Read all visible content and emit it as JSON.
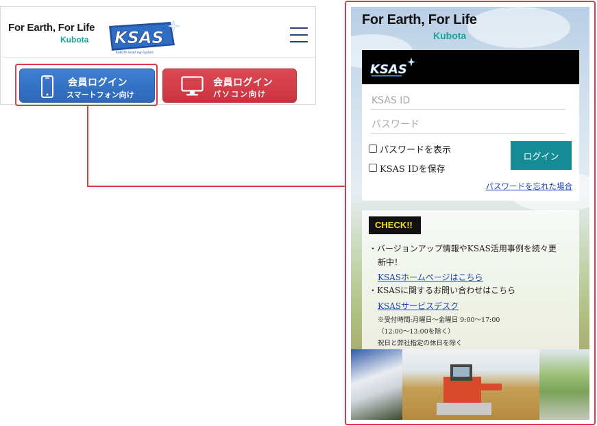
{
  "site_header": {
    "tagline": "For Earth, For Life",
    "brand": "Kubota",
    "logo_text": "KSAS",
    "logo_subtext": "KUBOTA Smart Agri System",
    "menu_icon": "hamburger-menu-icon"
  },
  "login_buttons": {
    "smartphone": {
      "line1": "会員ログイン",
      "line2": "スマートフォン向け",
      "icon": "smartphone-icon",
      "color": "#3371c4"
    },
    "pc": {
      "line1": "会員ログイン",
      "line2": "パソコン向け",
      "icon": "monitor-icon",
      "color": "#d43d49"
    }
  },
  "highlight_color": "#dc3a46",
  "phone_screen": {
    "tagline": "For Earth, For Life",
    "brand": "Kubota",
    "logo_text": "KSAS",
    "form": {
      "id_placeholder": "KSAS ID",
      "password_placeholder": "パスワード",
      "show_password_label": "パスワードを表示",
      "save_id_label": "KSAS IDを保存",
      "login_button": "ログイン",
      "forgot_link": "パスワードを忘れた場合",
      "button_color": "#158b96"
    },
    "check_panel": {
      "badge": "CHECK!!",
      "item1_text": "バージョンアップ情報やKSAS活用事例を続々更",
      "item1_text_cont": "新中！",
      "item1_link": "KSASホームページはこちら",
      "item2_text": "KSASに関するお問い合わせはこちら",
      "item2_link": "KSASサービスデスク",
      "hours": "※受付時間:月曜日〜金曜日 9:00〜17:00",
      "lunch": "（12:00〜13:00を除く）",
      "holidays": "祝日と弊社指定の休日を除く"
    }
  }
}
